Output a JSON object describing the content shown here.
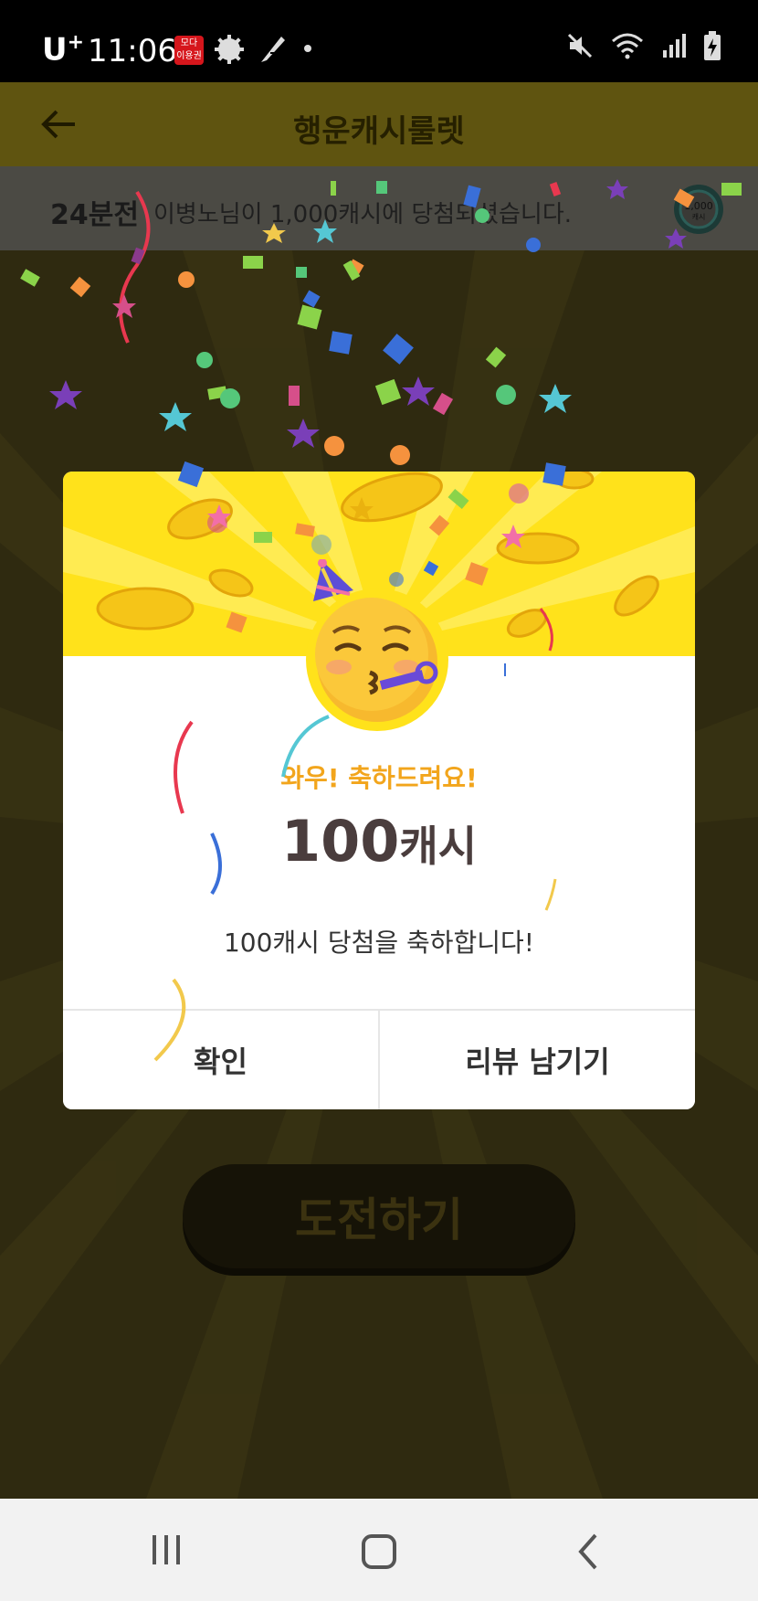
{
  "status_bar": {
    "carrier": "U",
    "carrier_sup": "+",
    "time": "11:06",
    "app_badge": [
      "모다",
      "이용권"
    ],
    "icons": [
      "moda-badge-icon",
      "gear-icon",
      "feather-icon",
      "dot-icon",
      "mute-icon",
      "wifi-icon",
      "signal-icon",
      "battery-charging-icon"
    ]
  },
  "app_bar": {
    "title": "행운캐시룰렛",
    "back_icon": "back-arrow-icon"
  },
  "ticker": {
    "time_ago": "24분전",
    "message": "이병노님이 1,000캐시에 당첨되셨습니다.",
    "coin_label": "1,000",
    "coin_unit": "캐시"
  },
  "dialog": {
    "congrats_small": "와우! 축하드려요!",
    "amount_value": "100",
    "amount_unit": "캐시",
    "message": "100캐시 당첨을 축하합니다!",
    "confirm_label": "확인",
    "review_label": "리뷰 남기기"
  },
  "challenge_button": {
    "label": "도전하기"
  },
  "nav_bar": {
    "icons": [
      "recent-apps-icon",
      "home-icon",
      "back-icon"
    ]
  },
  "colors": {
    "hero_yellow": "#ffe21b",
    "accent_orange": "#f2a51c",
    "amount_text": "#4a3d3d"
  }
}
